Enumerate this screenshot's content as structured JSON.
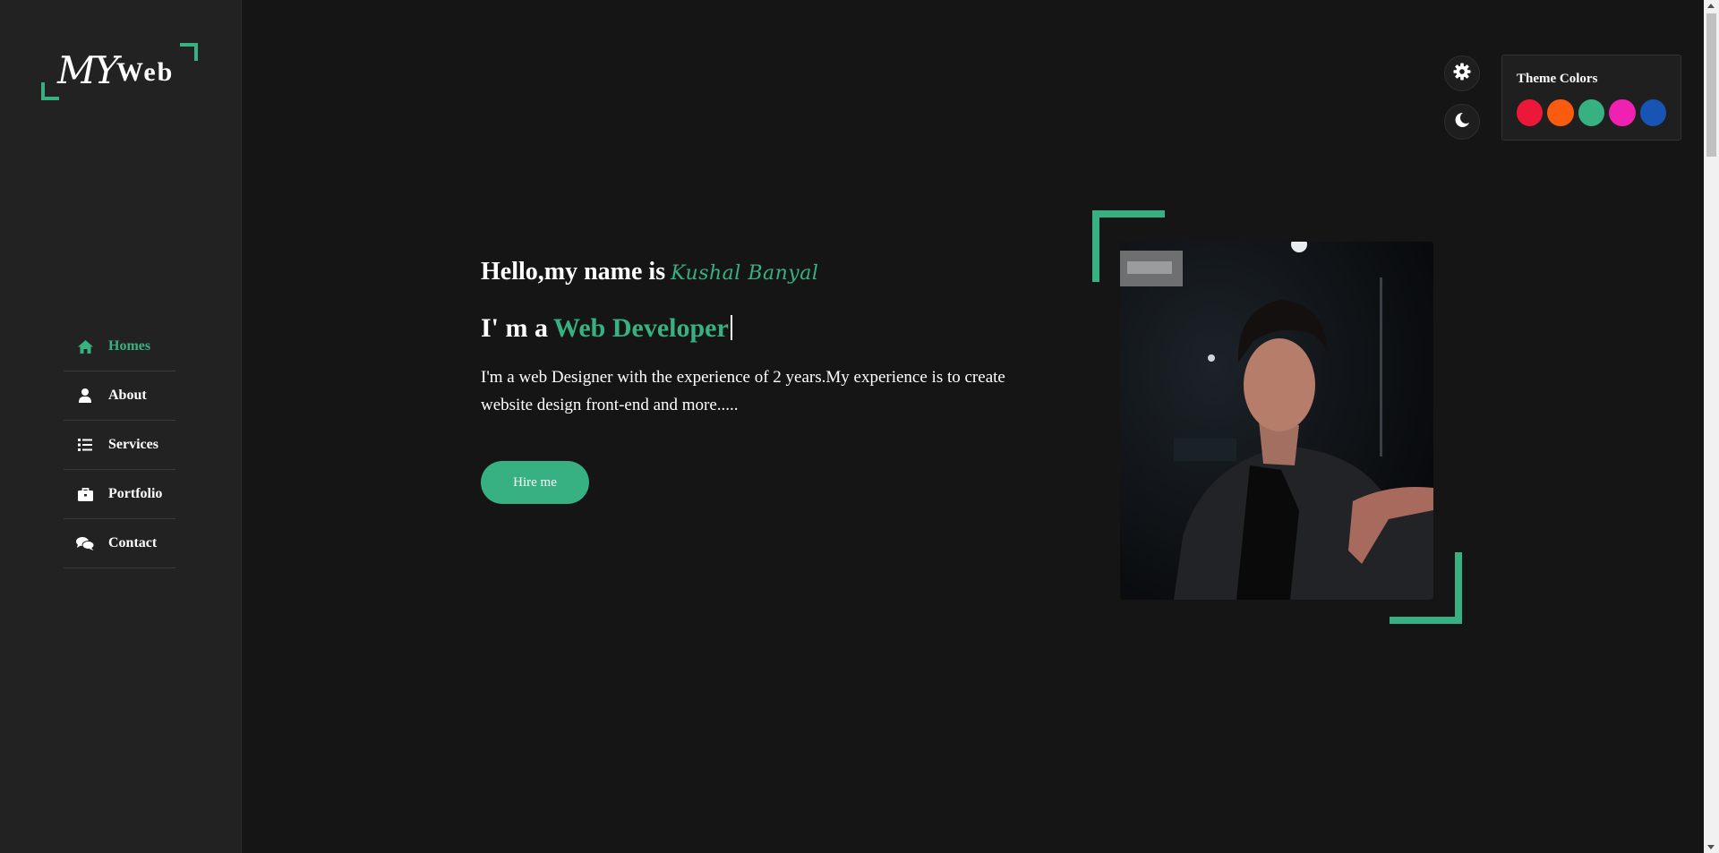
{
  "logo": {
    "script": "MY",
    "text": "Web"
  },
  "nav": {
    "items": [
      {
        "label": "Homes",
        "icon": "home-icon",
        "active": true
      },
      {
        "label": "About",
        "icon": "user-icon",
        "active": false
      },
      {
        "label": "Services",
        "icon": "list-icon",
        "active": false
      },
      {
        "label": "Portfolio",
        "icon": "briefcase-icon",
        "active": false
      },
      {
        "label": "Contact",
        "icon": "comments-icon",
        "active": false
      }
    ]
  },
  "controls": {
    "settings_icon": "gear-icon",
    "dark_mode_icon": "moon-icon"
  },
  "theme": {
    "title": "Theme Colors",
    "colors": [
      "#ec1839",
      "#fa5b0f",
      "#37b182",
      "#f021b2",
      "#1854b4"
    ]
  },
  "hero": {
    "greeting": "Hello,my name is",
    "name": "Kushal Banyal",
    "role_prefix": "I' m a",
    "role": "Web Developer",
    "description": "I'm a web Designer with the experience of 2 years.My experience is to create website design front-end and more.....",
    "button": "Hire me"
  },
  "colors": {
    "accent": "#37b182",
    "background": "#151515",
    "sidebar": "#222222"
  }
}
